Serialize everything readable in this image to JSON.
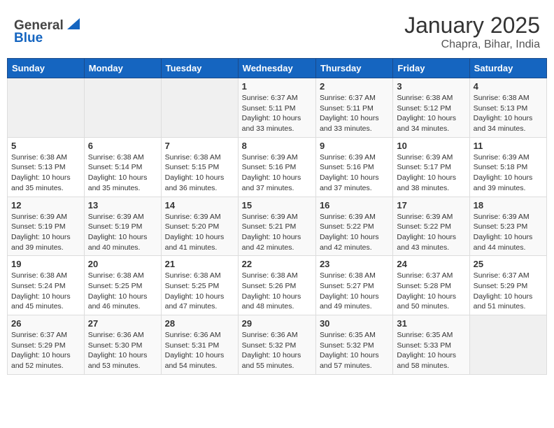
{
  "header": {
    "logo_general": "General",
    "logo_blue": "Blue",
    "month_year": "January 2025",
    "location": "Chapra, Bihar, India"
  },
  "days_of_week": [
    "Sunday",
    "Monday",
    "Tuesday",
    "Wednesday",
    "Thursday",
    "Friday",
    "Saturday"
  ],
  "weeks": [
    {
      "cells": [
        {
          "day": "",
          "info": ""
        },
        {
          "day": "",
          "info": ""
        },
        {
          "day": "",
          "info": ""
        },
        {
          "day": "1",
          "info": "Sunrise: 6:37 AM\nSunset: 5:11 PM\nDaylight: 10 hours\nand 33 minutes."
        },
        {
          "day": "2",
          "info": "Sunrise: 6:37 AM\nSunset: 5:11 PM\nDaylight: 10 hours\nand 33 minutes."
        },
        {
          "day": "3",
          "info": "Sunrise: 6:38 AM\nSunset: 5:12 PM\nDaylight: 10 hours\nand 34 minutes."
        },
        {
          "day": "4",
          "info": "Sunrise: 6:38 AM\nSunset: 5:13 PM\nDaylight: 10 hours\nand 34 minutes."
        }
      ]
    },
    {
      "cells": [
        {
          "day": "5",
          "info": "Sunrise: 6:38 AM\nSunset: 5:13 PM\nDaylight: 10 hours\nand 35 minutes."
        },
        {
          "day": "6",
          "info": "Sunrise: 6:38 AM\nSunset: 5:14 PM\nDaylight: 10 hours\nand 35 minutes."
        },
        {
          "day": "7",
          "info": "Sunrise: 6:38 AM\nSunset: 5:15 PM\nDaylight: 10 hours\nand 36 minutes."
        },
        {
          "day": "8",
          "info": "Sunrise: 6:39 AM\nSunset: 5:16 PM\nDaylight: 10 hours\nand 37 minutes."
        },
        {
          "day": "9",
          "info": "Sunrise: 6:39 AM\nSunset: 5:16 PM\nDaylight: 10 hours\nand 37 minutes."
        },
        {
          "day": "10",
          "info": "Sunrise: 6:39 AM\nSunset: 5:17 PM\nDaylight: 10 hours\nand 38 minutes."
        },
        {
          "day": "11",
          "info": "Sunrise: 6:39 AM\nSunset: 5:18 PM\nDaylight: 10 hours\nand 39 minutes."
        }
      ]
    },
    {
      "cells": [
        {
          "day": "12",
          "info": "Sunrise: 6:39 AM\nSunset: 5:19 PM\nDaylight: 10 hours\nand 39 minutes."
        },
        {
          "day": "13",
          "info": "Sunrise: 6:39 AM\nSunset: 5:19 PM\nDaylight: 10 hours\nand 40 minutes."
        },
        {
          "day": "14",
          "info": "Sunrise: 6:39 AM\nSunset: 5:20 PM\nDaylight: 10 hours\nand 41 minutes."
        },
        {
          "day": "15",
          "info": "Sunrise: 6:39 AM\nSunset: 5:21 PM\nDaylight: 10 hours\nand 42 minutes."
        },
        {
          "day": "16",
          "info": "Sunrise: 6:39 AM\nSunset: 5:22 PM\nDaylight: 10 hours\nand 42 minutes."
        },
        {
          "day": "17",
          "info": "Sunrise: 6:39 AM\nSunset: 5:22 PM\nDaylight: 10 hours\nand 43 minutes."
        },
        {
          "day": "18",
          "info": "Sunrise: 6:39 AM\nSunset: 5:23 PM\nDaylight: 10 hours\nand 44 minutes."
        }
      ]
    },
    {
      "cells": [
        {
          "day": "19",
          "info": "Sunrise: 6:38 AM\nSunset: 5:24 PM\nDaylight: 10 hours\nand 45 minutes."
        },
        {
          "day": "20",
          "info": "Sunrise: 6:38 AM\nSunset: 5:25 PM\nDaylight: 10 hours\nand 46 minutes."
        },
        {
          "day": "21",
          "info": "Sunrise: 6:38 AM\nSunset: 5:25 PM\nDaylight: 10 hours\nand 47 minutes."
        },
        {
          "day": "22",
          "info": "Sunrise: 6:38 AM\nSunset: 5:26 PM\nDaylight: 10 hours\nand 48 minutes."
        },
        {
          "day": "23",
          "info": "Sunrise: 6:38 AM\nSunset: 5:27 PM\nDaylight: 10 hours\nand 49 minutes."
        },
        {
          "day": "24",
          "info": "Sunrise: 6:37 AM\nSunset: 5:28 PM\nDaylight: 10 hours\nand 50 minutes."
        },
        {
          "day": "25",
          "info": "Sunrise: 6:37 AM\nSunset: 5:29 PM\nDaylight: 10 hours\nand 51 minutes."
        }
      ]
    },
    {
      "cells": [
        {
          "day": "26",
          "info": "Sunrise: 6:37 AM\nSunset: 5:29 PM\nDaylight: 10 hours\nand 52 minutes."
        },
        {
          "day": "27",
          "info": "Sunrise: 6:36 AM\nSunset: 5:30 PM\nDaylight: 10 hours\nand 53 minutes."
        },
        {
          "day": "28",
          "info": "Sunrise: 6:36 AM\nSunset: 5:31 PM\nDaylight: 10 hours\nand 54 minutes."
        },
        {
          "day": "29",
          "info": "Sunrise: 6:36 AM\nSunset: 5:32 PM\nDaylight: 10 hours\nand 55 minutes."
        },
        {
          "day": "30",
          "info": "Sunrise: 6:35 AM\nSunset: 5:32 PM\nDaylight: 10 hours\nand 57 minutes."
        },
        {
          "day": "31",
          "info": "Sunrise: 6:35 AM\nSunset: 5:33 PM\nDaylight: 10 hours\nand 58 minutes."
        },
        {
          "day": "",
          "info": ""
        }
      ]
    }
  ]
}
